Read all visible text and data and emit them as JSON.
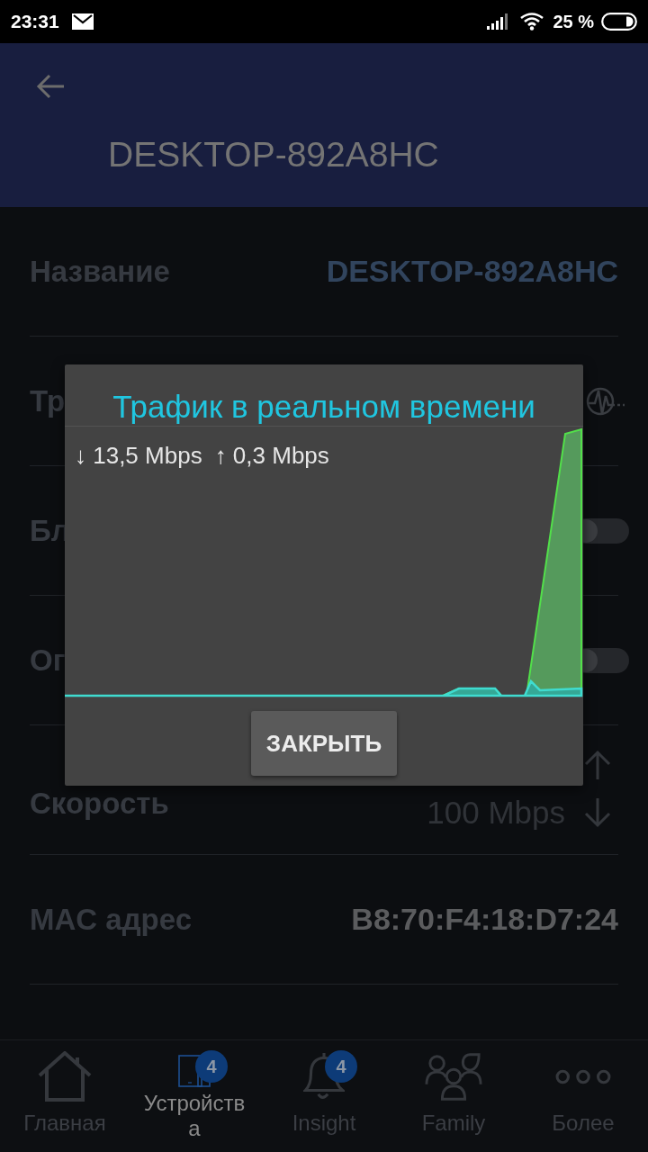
{
  "status_bar": {
    "time": "23:31",
    "battery": "25 %"
  },
  "app_bar": {
    "title": "DESKTOP-892A8HC"
  },
  "rows": [
    {
      "kind": "accent_value",
      "label": "Название",
      "value": "DESKTOP-892A8HC"
    },
    {
      "kind": "traffic",
      "label": "Тр"
    },
    {
      "kind": "toggle",
      "label": "Бл",
      "on": false
    },
    {
      "kind": "toggle",
      "label": "Ог",
      "on": false
    },
    {
      "kind": "speed",
      "label": "Скорость",
      "value": "100 Mbps"
    },
    {
      "kind": "value",
      "label": "MAC адрес",
      "value": "B8:70:F4:18:D7:24"
    }
  ],
  "dialog": {
    "title": "Трафик в реальном времени",
    "readings": [
      "↓ 13,5 Mbps",
      "↑ 0,3 Mbps"
    ],
    "button": "ЗАКРЫТЬ"
  },
  "nav": [
    {
      "kind": "home",
      "label": "Главная",
      "selected": false
    },
    {
      "kind": "devices",
      "label": "Устройства",
      "selected": true,
      "badge": "4"
    },
    {
      "kind": "bell",
      "label": "Insight",
      "selected": false,
      "badge": "4"
    },
    {
      "kind": "people",
      "label": "Family",
      "selected": false
    },
    {
      "kind": "more",
      "label": "Более",
      "selected": false
    }
  ]
}
